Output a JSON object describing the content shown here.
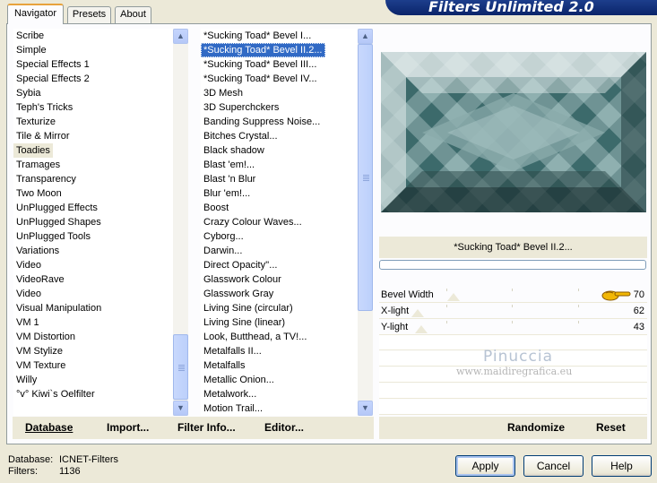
{
  "tabs": [
    "Navigator",
    "Presets",
    "About"
  ],
  "banner_title": "Filters Unlimited 2.0",
  "categories": {
    "items": [
      "Scribe",
      "Simple",
      "Special Effects 1",
      "Special Effects 2",
      "Sybia",
      "Teph's Tricks",
      "Texturize",
      "Tile & Mirror",
      "Toadies",
      "Tramages",
      "Transparency",
      "Two Moon",
      "UnPlugged Effects",
      "UnPlugged Shapes",
      "UnPlugged Tools",
      "Variations",
      "Video",
      "VideoRave",
      "Video",
      "Visual Manipulation",
      "VM 1",
      "VM Distortion",
      "VM Stylize",
      "VM Texture",
      "Willy",
      "°v° Kiwi`s Oelfilter"
    ],
    "selected": "Toadies"
  },
  "filters": {
    "items": [
      "*Sucking Toad*  Bevel I...",
      "*Sucking Toad*  Bevel II.2...",
      "*Sucking Toad*  Bevel III...",
      "*Sucking Toad*  Bevel IV...",
      "3D Mesh",
      "3D Superchckers",
      "Banding Suppress Noise...",
      "Bitches Crystal...",
      "Black shadow",
      "Blast 'em!...",
      "Blast 'n Blur",
      "Blur 'em!...",
      "Boost",
      "Crazy Colour Waves...",
      "Cyborg...",
      "Darwin...",
      "Direct Opacity''...",
      "Glasswork Colour",
      "Glasswork Gray",
      "Living Sine (circular)",
      "Living Sine (linear)",
      "Look, Butthead, a TV!...",
      "Metalfalls II...",
      "Metalfalls",
      "Metallic Onion...",
      "Metalwork...",
      "Motion Trail..."
    ],
    "selected": "*Sucking Toad*  Bevel II.2..."
  },
  "preview_title": "*Sucking Toad*  Bevel II.2...",
  "params": [
    {
      "label": "Bevel Width",
      "value": "70"
    },
    {
      "label": "X-light",
      "value": "62"
    },
    {
      "label": "Y-light",
      "value": "43"
    }
  ],
  "watermark": {
    "name": "Pinuccia",
    "site": "www.maidiregrafica.eu"
  },
  "left_buttons": {
    "database": "Database",
    "import": "Import...",
    "filter_info": "Filter Info...",
    "editor": "Editor..."
  },
  "right_buttons": {
    "randomize": "Randomize",
    "reset": "Reset"
  },
  "status": {
    "database_label": "Database:",
    "database_value": "ICNET-Filters",
    "filters_label": "Filters:",
    "filters_value": "1136"
  },
  "dialog_buttons": {
    "apply": "Apply",
    "cancel": "Cancel",
    "help": "Help"
  },
  "colors": {
    "selection": "#316ac5",
    "banner": "#0a246a",
    "pointer": "#f2b705"
  },
  "icons": {
    "scroll_up": "up-arrow-icon",
    "scroll_down": "down-arrow-icon",
    "pointer": "pointing-hand-icon"
  }
}
